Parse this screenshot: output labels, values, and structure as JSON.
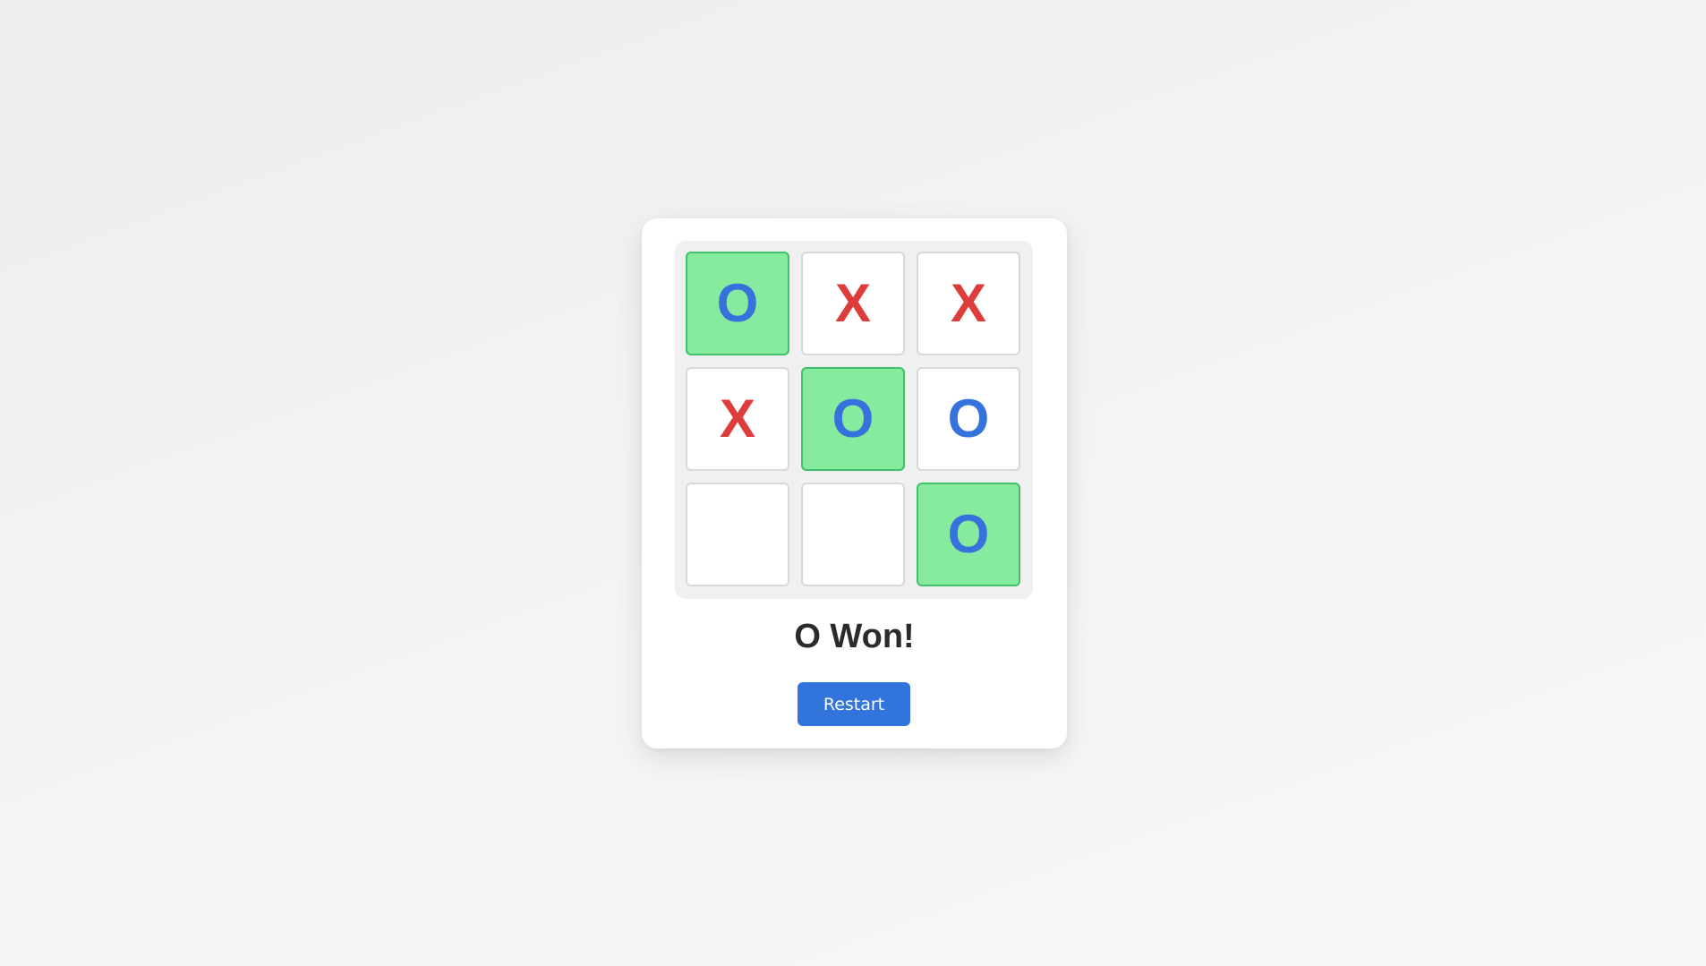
{
  "board": {
    "cells": [
      {
        "mark": "O",
        "winning": true
      },
      {
        "mark": "X",
        "winning": false
      },
      {
        "mark": "X",
        "winning": false
      },
      {
        "mark": "X",
        "winning": false
      },
      {
        "mark": "O",
        "winning": true
      },
      {
        "mark": "O",
        "winning": false
      },
      {
        "mark": "",
        "winning": false
      },
      {
        "mark": "",
        "winning": false
      },
      {
        "mark": "O",
        "winning": true
      }
    ]
  },
  "status": "O Won!",
  "restart_label": "Restart",
  "colors": {
    "x_mark": "#de3b3b",
    "o_mark": "#3572dc",
    "win_fill": "#86eb9e",
    "button": "#3174dc"
  }
}
